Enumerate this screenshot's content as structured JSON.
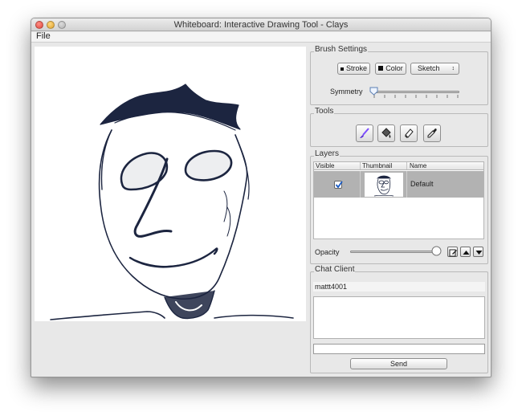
{
  "window": {
    "title": "Whiteboard: Interactive Drawing Tool - Clays"
  },
  "menu": {
    "file_label": "File"
  },
  "brush_settings": {
    "title": "Brush Settings",
    "stroke_label": "Stroke",
    "color_label": "Color",
    "mode_value": "Sketch",
    "symmetry_label": "Symmetry",
    "symmetry_level": 0
  },
  "tools": {
    "title": "Tools",
    "items": [
      "brush-icon",
      "paint-bucket-icon",
      "eraser-icon",
      "eyedropper-icon"
    ]
  },
  "layers": {
    "title": "Layers",
    "columns": [
      "Visible",
      "Thumbnail",
      "Name"
    ],
    "rows": [
      {
        "visible": true,
        "name": "Default"
      }
    ],
    "opacity_label": "Opacity",
    "opacity_level": 1.0
  },
  "chat": {
    "title": "Chat Client",
    "username": "mattt4001",
    "input_value": "",
    "send_label": "Send"
  },
  "colors": {
    "stroke": "#1c2540",
    "accent": "#7c4dff",
    "selection": "#b2b2b2"
  }
}
